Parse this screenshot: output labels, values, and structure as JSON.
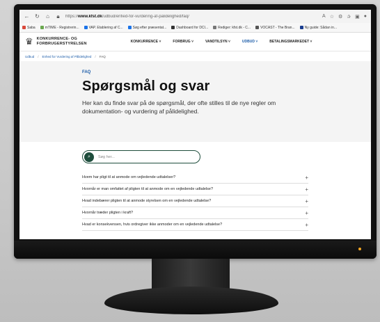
{
  "browser": {
    "url_prefix": "https://",
    "url_domain": "www.kfst.dk",
    "url_path": "/udbud/enfied-for-vurdering-af-palidelighed/faq/",
    "bookmarks": [
      {
        "label": "Saba",
        "color": "#d9483b"
      },
      {
        "label": "mTIME - Registrerin...",
        "color": "#6aa84f"
      },
      {
        "label": "VAP. Etablering af C...",
        "color": "#1a73e8"
      },
      {
        "label": "Søg efter præsentat...",
        "color": "#1a73e8"
      },
      {
        "label": "Dashboard for DCI...",
        "color": "#333333"
      },
      {
        "label": "Rediger: kfst.dk - C...",
        "color": "#777777"
      },
      {
        "label": "VOCAST - The Bran...",
        "color": "#555555"
      },
      {
        "label": "Ny guide: Sådan in...",
        "color": "#1a3d8f"
      }
    ]
  },
  "site": {
    "brand_line1": "KONKURRENCE- OG",
    "brand_line2": "FORBRUGERSTYRELSEN",
    "nav": [
      {
        "label": "KONKURRENCE ˅",
        "active": false
      },
      {
        "label": "FORBRUG ˅",
        "active": false
      },
      {
        "label": "VANDTILSYN ˅",
        "active": false
      },
      {
        "label": "UDBUD ˅",
        "active": true
      },
      {
        "label": "BETALINGSMARKEDET ˅",
        "active": false
      }
    ]
  },
  "breadcrumb": {
    "items": [
      "Udbud",
      "Enhed for Vurdering af Pålidelighed",
      "FAQ"
    ]
  },
  "hero": {
    "eyebrow": "FAQ",
    "title": "Spørgsmål og svar",
    "lead": "Her kan du finde svar på de spørgsmål, der ofte stilles til de nye regler om dokumentation- og vurdering af pålidelighed."
  },
  "faq": {
    "search_placeholder": "Søg her...",
    "items": [
      "Hvem har pligt til at anmode om vejledende udtalelser?",
      "Hvornår er man omfattet af pligten til at anmode om en vejledende udtalelse?",
      "Hvad indebærer pligten til at anmode styrelsen om en vejledende udtalelse?",
      "Hvornår træder pligten i kraft?",
      "Hvad er konsekvensen, hvis ordregiver ikke anmoder om en vejledende udtalelse?"
    ]
  }
}
